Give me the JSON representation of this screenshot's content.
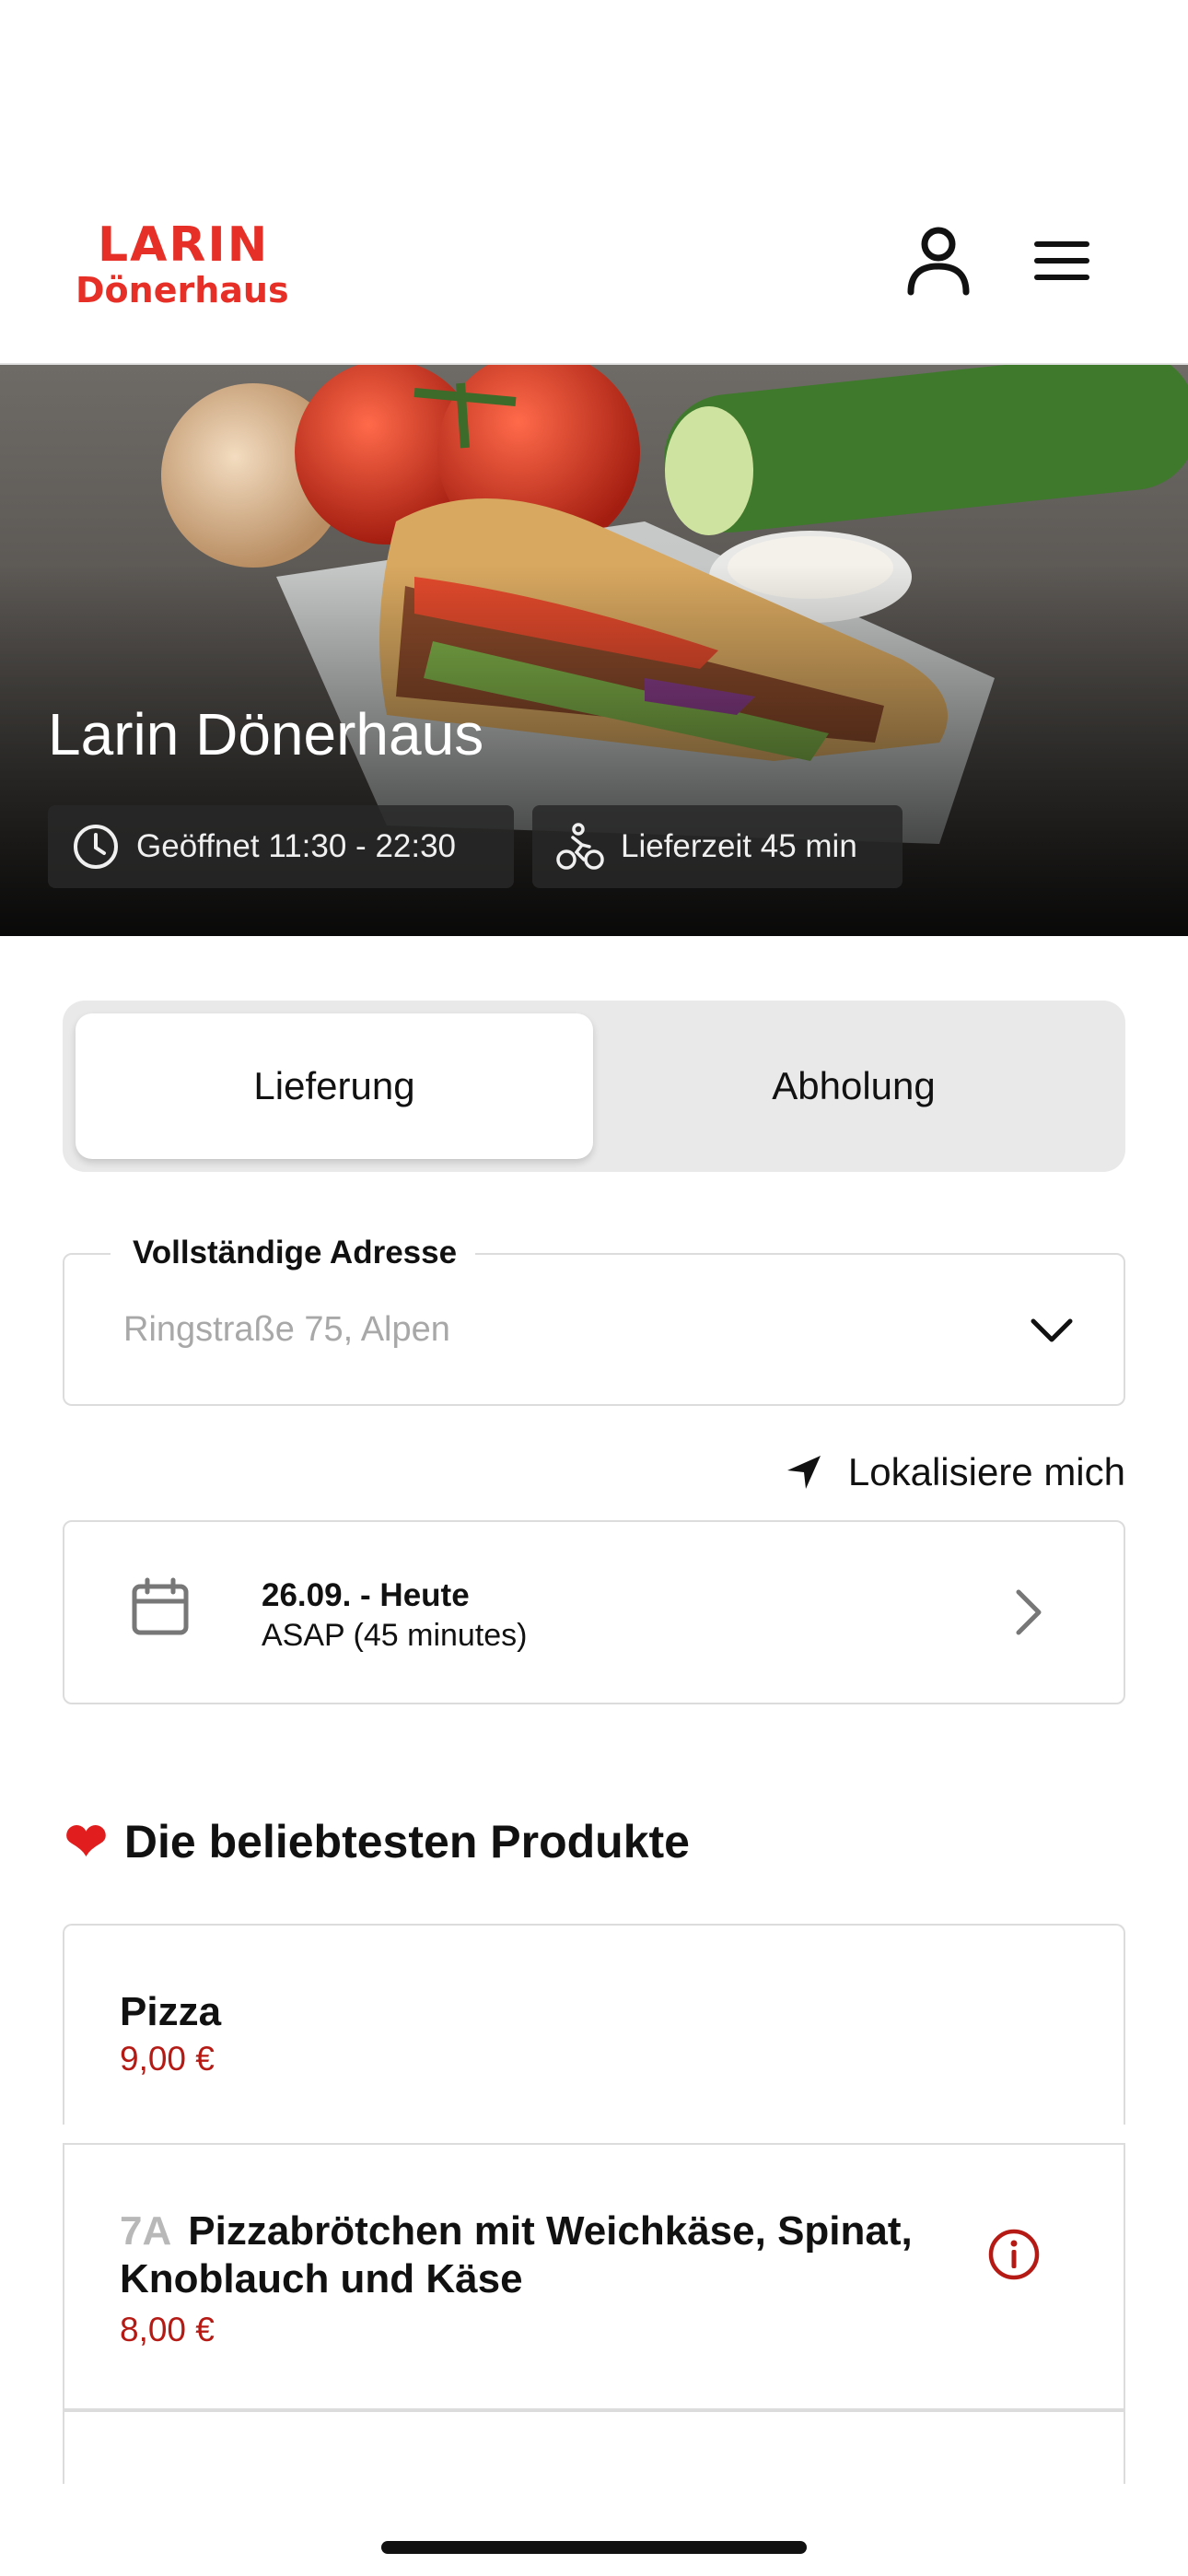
{
  "header": {
    "logo_line1": "LARIN",
    "logo_line2": "Dönerhaus",
    "brand_color": "#e63027",
    "icons": [
      "user-icon",
      "menu-icon"
    ]
  },
  "hero": {
    "title": "Larin Dönerhaus",
    "opening_hours": "Geöffnet 11:30 - 22:30",
    "delivery_time": "Lieferzeit 45 min"
  },
  "order_mode": {
    "delivery_label": "Lieferung",
    "pickup_label": "Abholung",
    "selected": "Lieferung"
  },
  "address": {
    "label": "Vollständige Adresse",
    "value": "Ringstraße 75,  Alpen"
  },
  "locate_label": "Lokalisiere mich",
  "schedule": {
    "date": "26.09. - Heute",
    "time": "ASAP (45 minutes)"
  },
  "popular": {
    "title": "Die beliebtesten Produkte",
    "products": [
      {
        "code": "",
        "name": "Pizza",
        "price": "9,00 €"
      },
      {
        "code": "7A",
        "name": "Pizzabrötchen mit Weichkäse, Spinat, Knoblauch und Käse",
        "price": "8,00 €"
      }
    ]
  },
  "colors": {
    "price": "#b51a14",
    "info_icon": "#b51a14"
  }
}
